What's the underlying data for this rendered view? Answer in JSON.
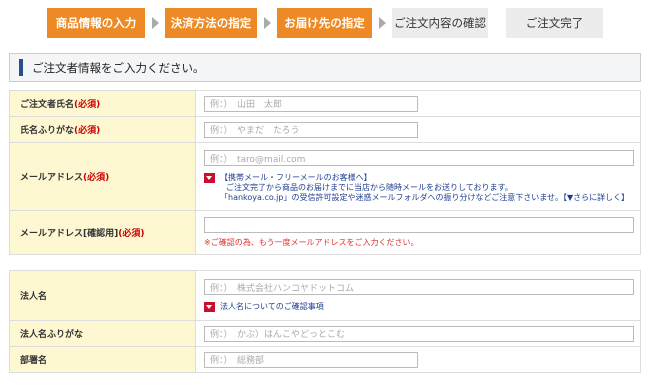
{
  "steps": [
    {
      "label": "商品情報の入力",
      "state": "active"
    },
    {
      "label": "決済方法の指定",
      "state": "active"
    },
    {
      "label": "お届け先の指定",
      "state": "active"
    },
    {
      "label": "ご注文内容の確認",
      "state": "inactive"
    },
    {
      "label": "ご注文完了",
      "state": "inactive"
    }
  ],
  "heading": {
    "title": "ご注文者情報をご入力ください。"
  },
  "form1": {
    "name": {
      "label": "ご注文者氏名",
      "required": "(必須)",
      "placeholder": "例：）　山田　太郎"
    },
    "kana": {
      "label": "氏名ふりがな",
      "required": "(必須)",
      "placeholder": "例：）　やまだ　たろう"
    },
    "email": {
      "label": "メールアドレス",
      "required": "(必須)",
      "placeholder": "例：）　taro@mail.com",
      "note_title": "【携帯メール・フリーメールのお客様へ】",
      "note_line1": "ご注文完了から商品のお届けまでに当店から随時メールをお送りしております。",
      "note_line2": "「hankoya.co.jp」の受信許可設定や迷惑メールフォルダへの振り分けなどご注意下さいませ。【▼さらに詳しく】"
    },
    "email_confirm": {
      "label": "メールアドレス[確認用]",
      "required": "(必須)",
      "warning": "※ご確認の為、もう一度メールアドレスをご入力ください。"
    }
  },
  "form2": {
    "company": {
      "label": "法人名",
      "placeholder": "例：）　株式会社ハンコヤドットコム",
      "note": "法人名についてのご確認事項"
    },
    "company_kana": {
      "label": "法人名ふりがな",
      "placeholder": "例：）　かぶ）はんこやどっとこむ"
    },
    "department": {
      "label": "部署名",
      "placeholder": "例：）　総務部"
    }
  },
  "colors": {
    "step_active": "#ee8a25",
    "step_inactive": "#ececec",
    "label_bg": "#fdf7d2",
    "required": "#cc0000",
    "link": "#1d3d8f"
  }
}
